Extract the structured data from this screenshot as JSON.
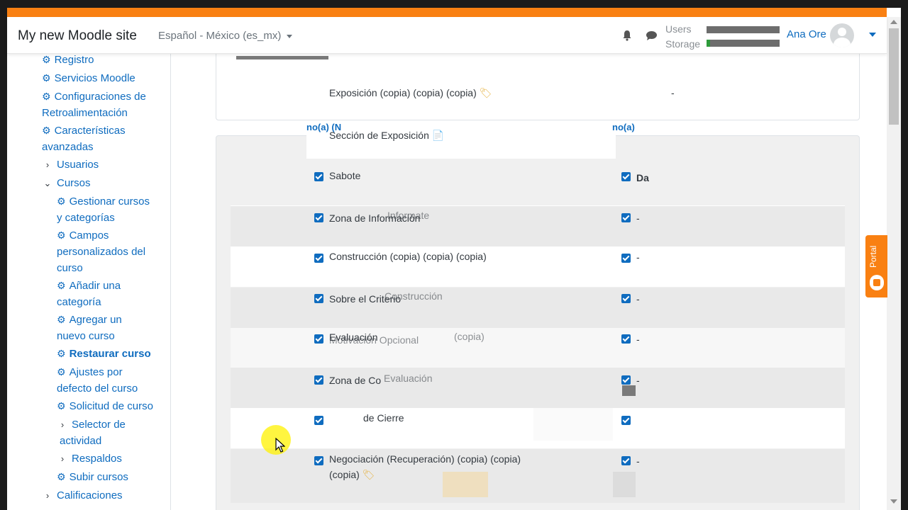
{
  "header": {
    "site_name": "My new Moodle site",
    "language": "Español - México (es_mx)",
    "quota_users_label": "Users",
    "quota_storage_label": "Storage",
    "username": "Ana Ore"
  },
  "sidebar": {
    "items": [
      {
        "label": "Registro"
      },
      {
        "label": "Servicios Moodle"
      },
      {
        "label": "Configuraciones de"
      },
      {
        "label": "Retroalimentación"
      },
      {
        "label": "Características"
      },
      {
        "label": "avanzadas"
      },
      {
        "label": "Usuarios"
      },
      {
        "label": "Cursos"
      },
      {
        "label": "Gestionar cursos"
      },
      {
        "label": "y categorías"
      },
      {
        "label": "Campos"
      },
      {
        "label": "personalizados del"
      },
      {
        "label": "curso"
      },
      {
        "label": "Añadir una"
      },
      {
        "label": "categoría"
      },
      {
        "label": "Agregar un"
      },
      {
        "label": "nuevo curso"
      },
      {
        "label": "Restaurar curso"
      },
      {
        "label": "Ajustes por"
      },
      {
        "label": "defecto del curso"
      },
      {
        "label": "Solicitud de curso"
      },
      {
        "label": "Selector de"
      },
      {
        "label": "actividad"
      },
      {
        "label": "Respaldos"
      },
      {
        "label": "Subir cursos"
      },
      {
        "label": "Calificaciones"
      }
    ]
  },
  "main": {
    "column_header_left": "no(a)",
    "column_header_left_suffix": "(N",
    "column_header_right": "no(a)",
    "rows": [
      {
        "label": "Exposición (copia) (copia) (copia)",
        "value": "-"
      },
      {
        "label": "Sección de Exposición",
        "value": ""
      },
      {
        "label": "Sabote",
        "value": "Da"
      },
      {
        "label": "Zona de Información",
        "value": "-"
      },
      {
        "label": "Construcción (copia) (copia) (copia)",
        "value": "-"
      },
      {
        "label": "Sobre el Criterio",
        "value": "-"
      },
      {
        "label": "Evaluación",
        "value": "-"
      },
      {
        "label": "Zona de Co",
        "value": "-"
      },
      {
        "label": "de Cierre",
        "value": ""
      },
      {
        "label": "Negociación (Recuperación) (copia) (copia)",
        "value": "-"
      },
      {
        "label": "(copia)",
        "value": ""
      }
    ],
    "ghost_texts": [
      "Construcción",
      "Evaluación",
      "(copia)",
      "Motivación Opcional",
      "Informate"
    ]
  },
  "portal": {
    "label": "Portal"
  },
  "colors": {
    "accent": "#0f6cbf",
    "brand_orange": "#f98012",
    "checkbox": "#0f6cbf"
  }
}
